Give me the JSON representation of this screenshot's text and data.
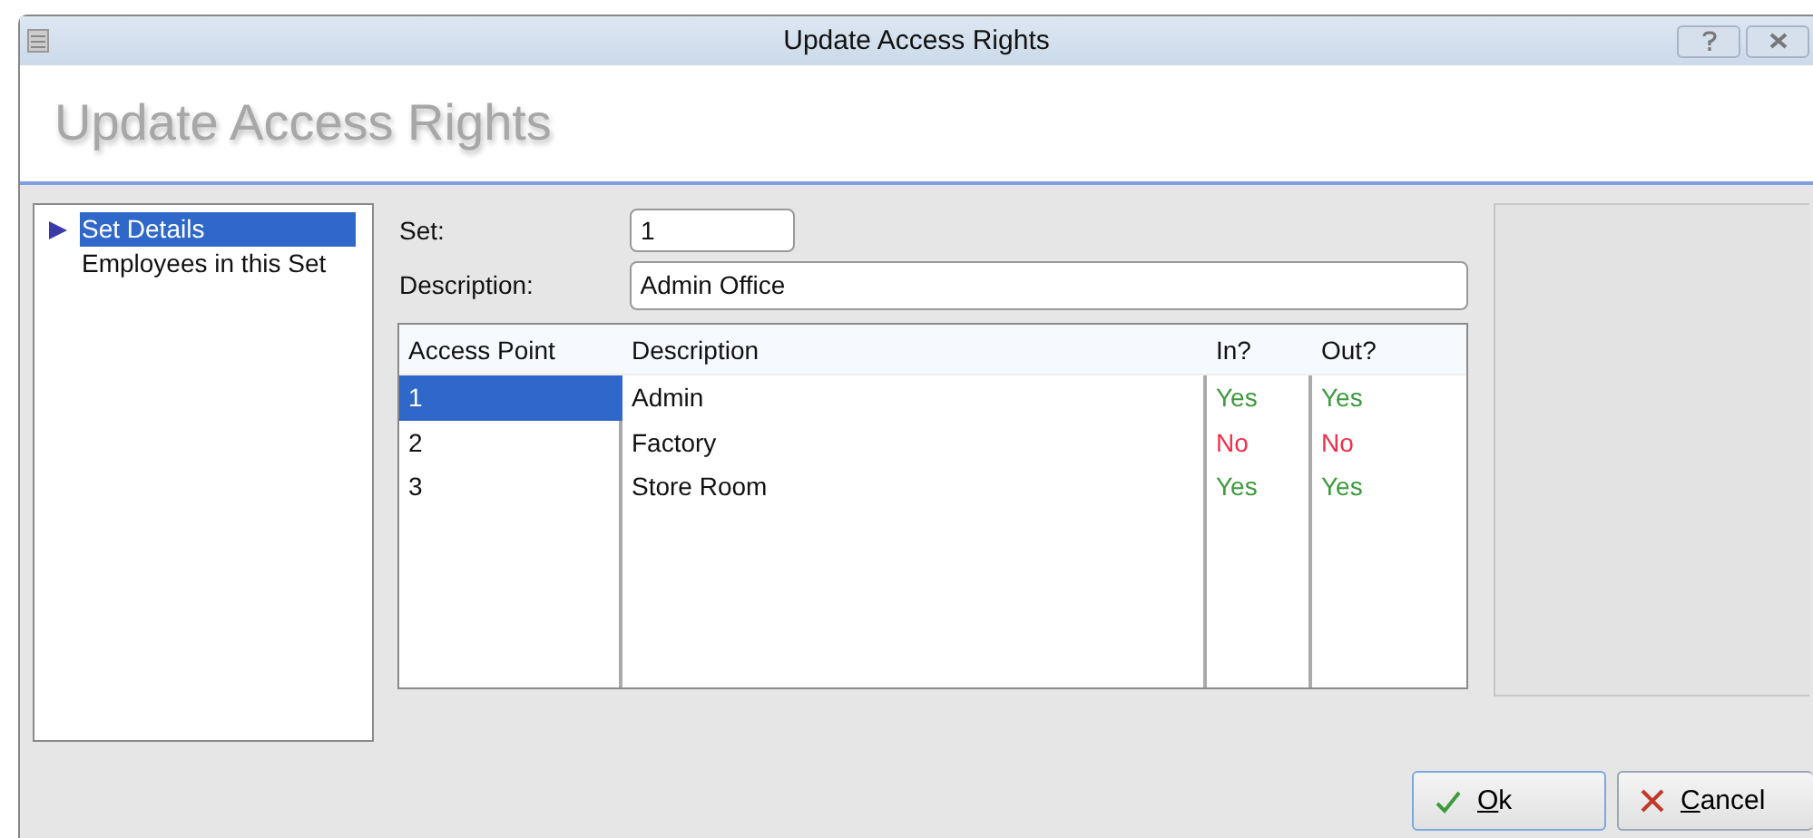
{
  "window": {
    "title": "Update Access Rights"
  },
  "header": {
    "title": "Update Access Rights"
  },
  "nav": [
    {
      "label": "Set Details",
      "selected": true
    },
    {
      "label": "Employees in this Set",
      "selected": false
    }
  ],
  "form": {
    "set_label": "Set:",
    "set_value": "1",
    "description_label": "Description:",
    "description_value": "Admin Office"
  },
  "table": {
    "columns": [
      "Access Point",
      "Description",
      "In?",
      "Out?"
    ],
    "rows": [
      {
        "access_point": "1",
        "description": "Admin",
        "in": "Yes",
        "in_allowed": true,
        "out": "Yes",
        "out_allowed": true,
        "selected": true
      },
      {
        "access_point": "2",
        "description": "Factory",
        "in": "No",
        "in_allowed": false,
        "out": "No",
        "out_allowed": false,
        "selected": false
      },
      {
        "access_point": "3",
        "description": "Store Room",
        "in": "Yes",
        "in_allowed": true,
        "out": "Yes",
        "out_allowed": true,
        "selected": false
      }
    ]
  },
  "buttons": [
    {
      "kind": "ok",
      "label": "Ok"
    },
    {
      "kind": "cancel",
      "label": "Cancel"
    }
  ]
}
